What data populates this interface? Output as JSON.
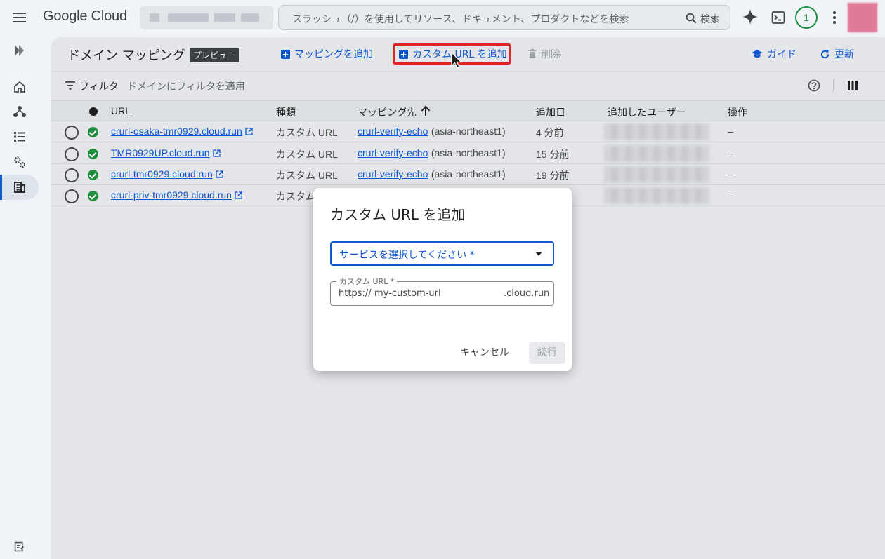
{
  "topbar": {
    "brand": "Google Cloud",
    "search_placeholder": "スラッシュ（/）を使用してリソース、ドキュメント、プロダクトなどを検索",
    "search_button": "検索",
    "notification_count": "1"
  },
  "toolbar": {
    "title": "ドメイン マッピング",
    "badge": "プレビュー",
    "add_mapping": "マッピングを追加",
    "add_custom_url": "カスタム URL を追加",
    "delete": "削除",
    "guide": "ガイド",
    "refresh": "更新"
  },
  "filter": {
    "label": "フィルタ",
    "hint": "ドメインにフィルタを適用"
  },
  "table": {
    "headers": [
      "URL",
      "種類",
      "マッピング先",
      "追加日",
      "追加したユーザー",
      "操作"
    ],
    "rows": [
      {
        "url": "crurl-osaka-tmr0929.cloud.run",
        "type": "カスタム URL",
        "target": "crurl-verify-echo",
        "region": "(asia-northeast1)",
        "added": "4 分前",
        "action": "–"
      },
      {
        "url": "TMR0929UP.cloud.run",
        "type": "カスタム URL",
        "target": "crurl-verify-echo",
        "region": "(asia-northeast1)",
        "added": "15 分前",
        "action": "–"
      },
      {
        "url": "crurl-tmr0929.cloud.run",
        "type": "カスタム URL",
        "target": "crurl-verify-echo",
        "region": "(asia-northeast1)",
        "added": "19 分前",
        "action": "–"
      },
      {
        "url": "crurl-priv-tmr0929.cloud.run",
        "type": "カスタム",
        "target": "",
        "region": "",
        "added": "",
        "action": "–"
      }
    ]
  },
  "dialog": {
    "title": "カスタム URL を追加",
    "service_placeholder": "サービスを選択してください *",
    "custom_url_label": "カスタム URL *",
    "prefix": "https://",
    "input_placeholder": "my-custom-url",
    "suffix": ".cloud.run",
    "cancel": "キャンセル",
    "continue": "続行"
  },
  "colors": {
    "primary": "#0b57d0",
    "success": "#1e8e3e",
    "highlight": "#e02424"
  }
}
